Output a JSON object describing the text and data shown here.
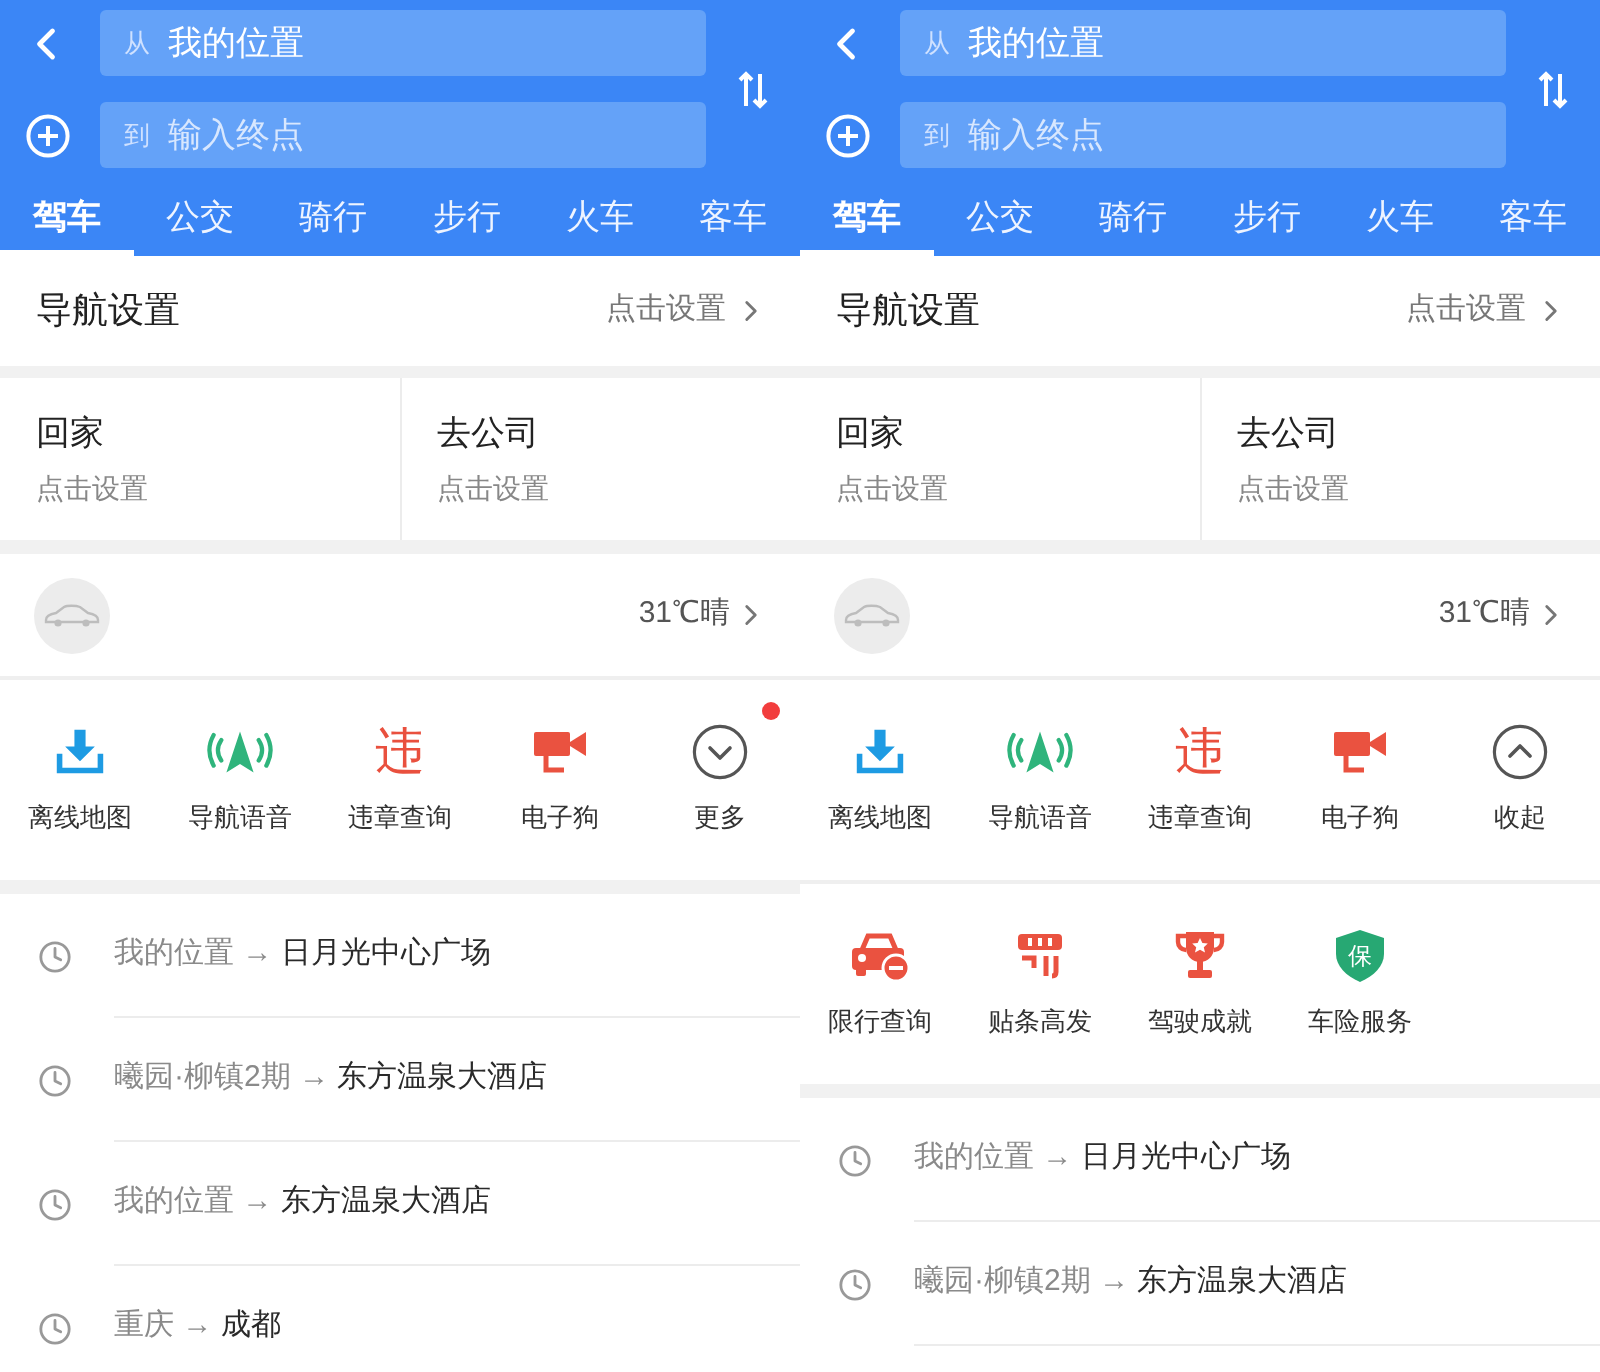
{
  "screens": [
    {
      "header": {
        "from": {
          "prefix": "从",
          "value": "我的位置"
        },
        "to": {
          "prefix": "到",
          "placeholder": "输入终点"
        }
      },
      "tabs": [
        {
          "label": "驾车",
          "selected": true
        },
        {
          "label": "公交",
          "selected": false
        },
        {
          "label": "骑行",
          "selected": false
        },
        {
          "label": "步行",
          "selected": false
        },
        {
          "label": "火车",
          "selected": false
        },
        {
          "label": "客车",
          "selected": false
        }
      ],
      "nav_settings": {
        "title": "导航设置",
        "action": "点击设置"
      },
      "shortcuts": [
        {
          "title": "回家",
          "subtitle": "点击设置"
        },
        {
          "title": "去公司",
          "subtitle": "点击设置"
        }
      ],
      "car": {
        "weather": "31℃晴"
      },
      "tool_rows": [
        {
          "items": [
            {
              "kind": "download",
              "label": "离线地图",
              "dot": false
            },
            {
              "kind": "voice",
              "label": "导航语音",
              "dot": false
            },
            {
              "kind": "glyph",
              "glyph": "违",
              "label": "违章查询",
              "dot": false
            },
            {
              "kind": "camera",
              "label": "电子狗",
              "dot": false
            },
            {
              "kind": "expand",
              "label": "更多",
              "dot": true
            }
          ]
        }
      ],
      "history": [
        {
          "route": "我的位置 → **日月光中心广场**"
        },
        {
          "route": "曦园·柳镇2期 → **东方温泉大酒店**"
        },
        {
          "route": "我的位置 → **东方温泉大酒店**"
        },
        {
          "route": "重庆 → **成都**"
        }
      ]
    },
    {
      "header": {
        "from": {
          "prefix": "从",
          "value": "我的位置"
        },
        "to": {
          "prefix": "到",
          "placeholder": "输入终点"
        }
      },
      "tabs": [
        {
          "label": "驾车",
          "selected": true
        },
        {
          "label": "公交",
          "selected": false
        },
        {
          "label": "骑行",
          "selected": false
        },
        {
          "label": "步行",
          "selected": false
        },
        {
          "label": "火车",
          "selected": false
        },
        {
          "label": "客车",
          "selected": false
        }
      ],
      "nav_settings": {
        "title": "导航设置",
        "action": "点击设置"
      },
      "shortcuts": [
        {
          "title": "回家",
          "subtitle": "点击设置"
        },
        {
          "title": "去公司",
          "subtitle": "点击设置"
        }
      ],
      "car": {
        "weather": "31℃晴"
      },
      "tool_rows": [
        {
          "items": [
            {
              "kind": "download",
              "label": "离线地图",
              "dot": false
            },
            {
              "kind": "voice",
              "label": "导航语音",
              "dot": false
            },
            {
              "kind": "glyph",
              "glyph": "违",
              "label": "违章查询",
              "dot": false
            },
            {
              "kind": "camera",
              "label": "电子狗",
              "dot": false
            },
            {
              "kind": "collapse",
              "label": "收起",
              "dot": false
            }
          ]
        },
        {
          "items": [
            {
              "kind": "car_restrict",
              "label": "限行查询",
              "dot": false
            },
            {
              "kind": "gate",
              "label": "贴条高发",
              "dot": false
            },
            {
              "kind": "trophy",
              "label": "驾驶成就",
              "dot": false
            },
            {
              "kind": "shield",
              "glyph": "保",
              "label": "车险服务",
              "dot": false
            }
          ]
        }
      ],
      "history": [
        {
          "route": "我的位置 → **日月光中心广场**"
        },
        {
          "route": "曦园·柳镇2期 → **东方温泉大酒店**"
        }
      ]
    }
  ]
}
